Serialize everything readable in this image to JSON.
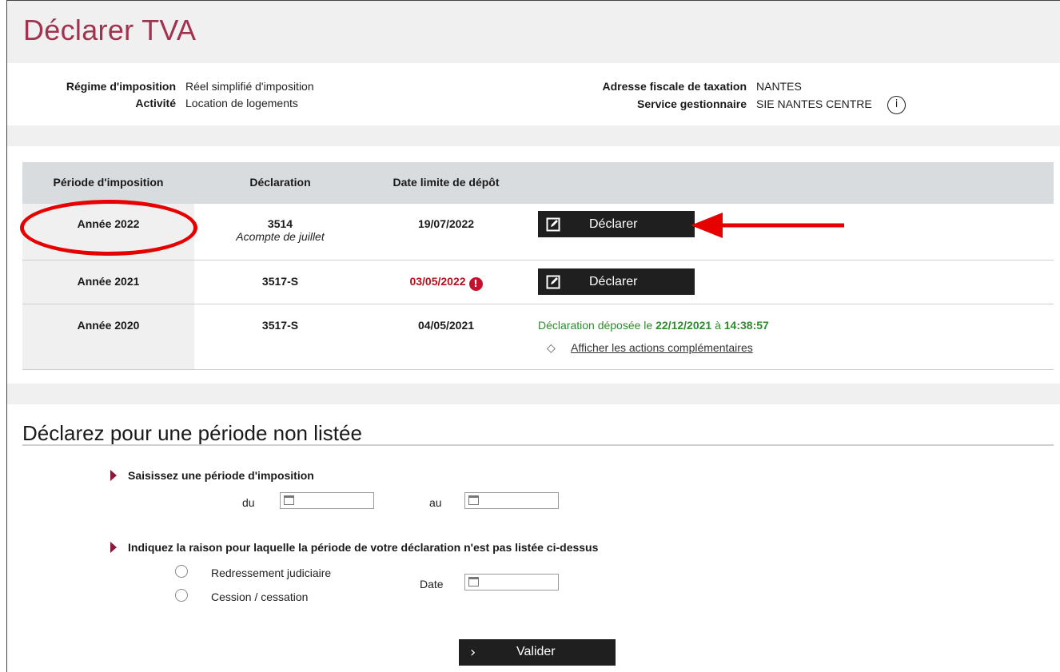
{
  "header": {
    "title": "Déclarer TVA"
  },
  "info": {
    "regime_label": "Régime d'imposition",
    "regime_value": "Réel simplifié d'imposition",
    "activity_label": "Activité",
    "activity_value": "Location de logements",
    "address_label": "Adresse fiscale de taxation",
    "address_value": "NANTES",
    "service_label": "Service gestionnaire",
    "service_value": "SIE NANTES CENTRE",
    "info_icon": "i"
  },
  "table": {
    "headers": [
      "Période d'imposition",
      "Déclaration",
      "Date limite de dépôt"
    ],
    "rows": [
      {
        "period": "Année 2022",
        "declaration": "3514",
        "declaration_sub": "Acompte de juillet",
        "deadline": "19/07/2022",
        "action": "Déclarer"
      },
      {
        "period": "Année 2021",
        "declaration": "3517-S",
        "deadline": "03/05/2022",
        "deadline_warn": "!",
        "action": "Déclarer"
      },
      {
        "period": "Année 2020",
        "declaration": "3517-S",
        "deadline": "04/05/2021",
        "status_prefix": "Déclaration déposée le ",
        "status_date": "22/12/2021",
        "status_mid": " à ",
        "status_time": "14:38:57",
        "more_actions": "Afficher les actions complémentaires"
      }
    ]
  },
  "unlisted": {
    "title": "Déclarez pour une période non listée",
    "step1": "Saisissez une période d'imposition",
    "from_label": "du",
    "to_label": "au",
    "step2": "Indiquez la raison pour laquelle la période de votre déclaration n'est pas listée ci-dessus",
    "reason1": "Redressement judiciaire",
    "reason2": "Cession / cessation",
    "date_label": "Date",
    "submit": "Valider"
  },
  "colors": {
    "title": "#a0334f",
    "annotation": "#e60000",
    "deposited": "#2e8b2e",
    "overdue": "#b3121d"
  }
}
